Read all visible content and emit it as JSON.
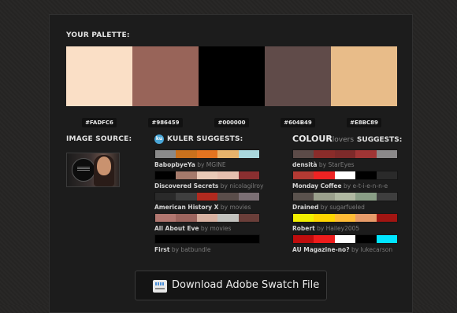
{
  "palette": {
    "title": "YOUR PALETTE:",
    "swatches": [
      {
        "hex": "#FADFC6",
        "color": "#FADFC6"
      },
      {
        "hex": "#986459",
        "color": "#986459"
      },
      {
        "hex": "#000000",
        "color": "#000000"
      },
      {
        "hex": "#604B49",
        "color": "#604B49"
      },
      {
        "hex": "#E8BC89",
        "color": "#E8BC89"
      }
    ]
  },
  "image_source": {
    "title": "IMAGE SOURCE:"
  },
  "kuler": {
    "title": "KULER SUGGESTS:",
    "icon_text": "ku",
    "items": [
      {
        "name": "BabopbyeYa",
        "by": "by MGINE",
        "colors": [
          "#8a8a8a",
          "#c9711d",
          "#e47420",
          "#e7b36c",
          "#a9d7dc"
        ]
      },
      {
        "name": "Discovered Secrets",
        "by": "by nicolagilroy",
        "colors": [
          "#000000",
          "#a57a6b",
          "#e9c9b6",
          "#e6bfae",
          "#8a2f30"
        ]
      },
      {
        "name": "American History X",
        "by": "by movies",
        "colors": [
          "#2a2a2a",
          "#3f3f3f",
          "#b12a1f",
          "#5a4d4a",
          "#7b6f74"
        ]
      },
      {
        "name": "All About Eve",
        "by": "by movies",
        "colors": [
          "#b27770",
          "#9d655e",
          "#d8b1a1",
          "#c2c2be",
          "#6a3e39"
        ]
      },
      {
        "name": "First",
        "by": "by batbundle",
        "colors": [
          "#000000",
          "#000000",
          "#000000",
          "#000000",
          "#000000"
        ]
      }
    ]
  },
  "colourlovers": {
    "brand": "COLOUR",
    "brand_suffix": "lovers",
    "title": "SUGGESTS:",
    "items": [
      {
        "name": "densità",
        "by": "by StarEyes",
        "colors": [
          "#5c4b48",
          "#8a2c2a",
          "#7d2a2a",
          "#a03535",
          "#8b898a"
        ]
      },
      {
        "name": "Monday Coffee",
        "by": "by e-t-i-e-n-n-e",
        "colors": [
          "#b33a33",
          "#ee2323",
          "#ffffff",
          "#000000",
          "#2a2a2a"
        ]
      },
      {
        "name": "Drained",
        "by": "by sugarfueled",
        "colors": [
          "#5a524d",
          "#9aa08c",
          "#afb8a1",
          "#899e86",
          "#3e3e3e"
        ]
      },
      {
        "name": "Robert",
        "by": "by Hailey2005",
        "colors": [
          "#f2ef00",
          "#ffd500",
          "#ffbb36",
          "#e79b69",
          "#a11512"
        ]
      },
      {
        "name": "AU Magazine-no?",
        "by": "by lukecarson",
        "colors": [
          "#be0d0d",
          "#ee1c1c",
          "#ffffff",
          "#000000",
          "#00e5ff"
        ]
      }
    ]
  },
  "download": {
    "label": "Download Adobe Swatch File",
    "icon": "swatch-file-icon"
  }
}
